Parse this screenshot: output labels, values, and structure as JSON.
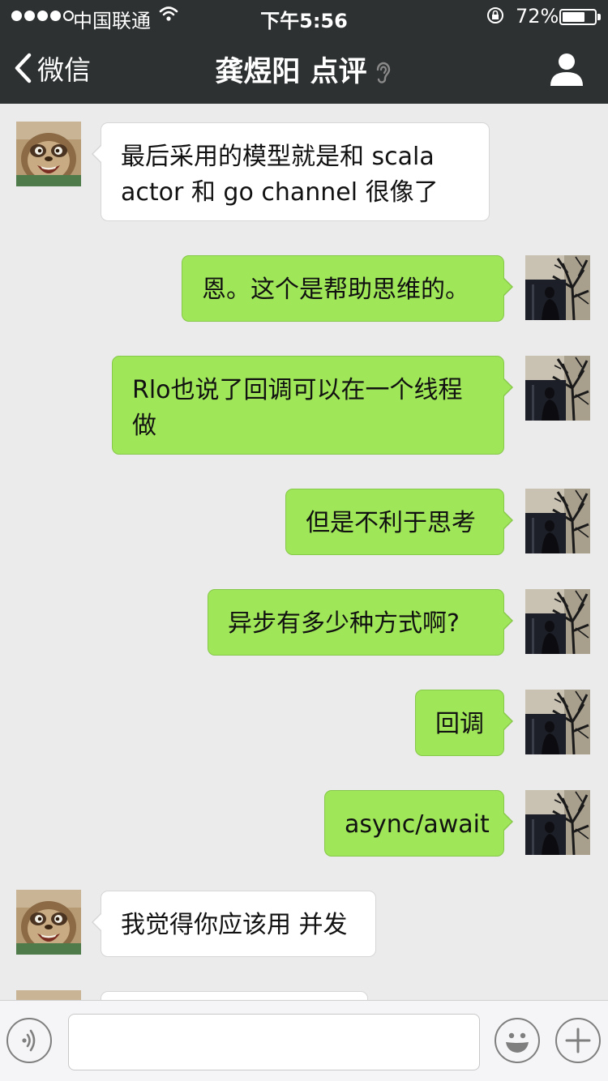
{
  "status_bar": {
    "carrier": "中国联通",
    "time": "下午5:56",
    "battery_percent": "72%",
    "battery_level": 0.72,
    "signal_bars_filled": 4,
    "signal_bars_total": 5
  },
  "nav": {
    "back_label": "微信",
    "title": "龚煜阳 点评",
    "icons": [
      "chevron-left-icon",
      "ear-icon",
      "profile-icon"
    ]
  },
  "messages": [
    {
      "side": "left",
      "avatar": "sloth-avatar",
      "text": "最后采用的模型就是和 scala actor 和 go channel 很像了"
    },
    {
      "side": "right",
      "avatar": "tree-avatar",
      "text": "恩。这个是帮助思维的。"
    },
    {
      "side": "right",
      "avatar": "tree-avatar",
      "text": "Rlo也说了回调可以在一个线程做"
    },
    {
      "side": "right",
      "avatar": "tree-avatar",
      "text": "但是不利于思考"
    },
    {
      "side": "right",
      "avatar": "tree-avatar",
      "text": "异步有多少种方式啊?"
    },
    {
      "side": "right",
      "avatar": "tree-avatar",
      "text": "回调"
    },
    {
      "side": "right",
      "avatar": "tree-avatar",
      "text": "async/await"
    },
    {
      "side": "left",
      "avatar": "sloth-avatar",
      "text": "我觉得你应该用 并发"
    },
    {
      "side": "left",
      "avatar": "sloth-avatar",
      "text": ""
    }
  ],
  "input_bar": {
    "value": "",
    "icons": [
      "voice-icon",
      "emoji-icon",
      "plus-icon"
    ]
  },
  "colors": {
    "nav_bg": "#2e3132",
    "chat_bg": "#ebebeb",
    "bubble_right": "#9fe658",
    "bubble_left": "#ffffff"
  }
}
